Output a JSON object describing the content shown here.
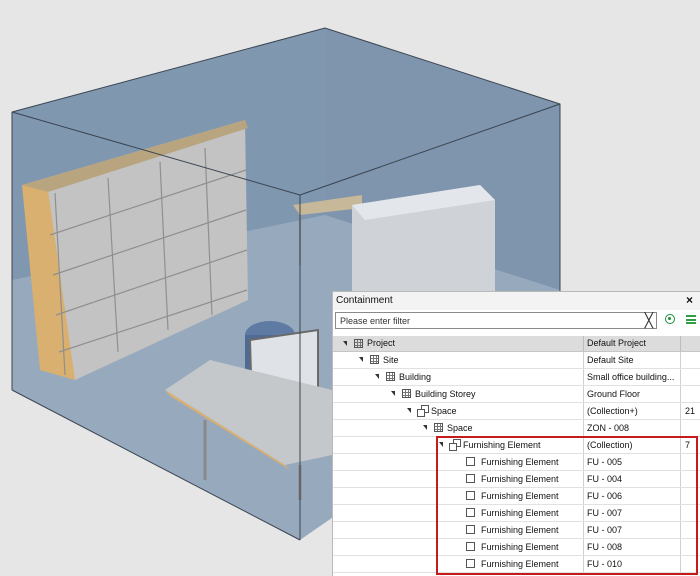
{
  "panel": {
    "title": "Containment",
    "close_glyph": "×",
    "filter": {
      "placeholder": "Please enter filter",
      "clear_glyph": "╳"
    },
    "icons": {
      "radio": "radio-target-icon",
      "menu": "hamburger-menu-icon"
    },
    "columns": [
      "Project",
      "Default Project"
    ],
    "rows": [
      {
        "name": "Site",
        "value": "Default Site",
        "count": ""
      },
      {
        "name": "Building",
        "value": "Small office building...",
        "count": ""
      },
      {
        "name": "Building Storey",
        "value": "Ground Floor",
        "count": ""
      },
      {
        "name": "Space",
        "value": "(Collection+)",
        "count": "21"
      },
      {
        "name": "Space",
        "value": "ZON - 008",
        "count": ""
      },
      {
        "name": "Furnishing Element",
        "value": "(Collection)",
        "count": "7"
      },
      {
        "name": "Furnishing Element",
        "value": "FU - 005",
        "count": ""
      },
      {
        "name": "Furnishing Element",
        "value": "FU - 004",
        "count": ""
      },
      {
        "name": "Furnishing Element",
        "value": "FU - 006",
        "count": ""
      },
      {
        "name": "Furnishing Element",
        "value": "FU - 007",
        "count": ""
      },
      {
        "name": "Furnishing Element",
        "value": "FU - 007",
        "count": ""
      },
      {
        "name": "Furnishing Element",
        "value": "FU - 008",
        "count": ""
      },
      {
        "name": "Furnishing Element",
        "value": "FU - 010",
        "count": ""
      }
    ]
  },
  "colors": {
    "highlight": "#c41c1c",
    "arrow": "#2ea043",
    "space_volume": "#6f8aa8",
    "wood": "#d9b06f"
  }
}
